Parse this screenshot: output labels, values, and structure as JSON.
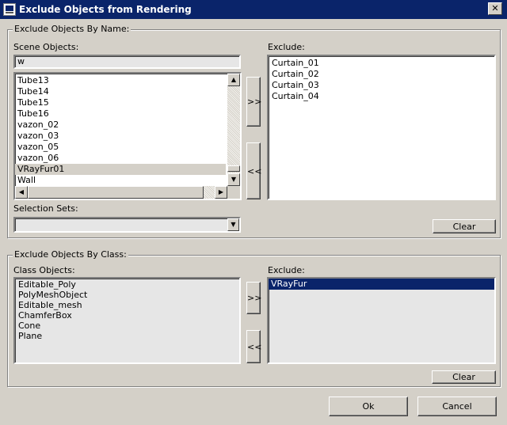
{
  "window": {
    "title": "Exclude Objects from Rendering",
    "close_glyph": "✕"
  },
  "by_name": {
    "group_title": "Exclude Objects By Name:",
    "scene_label": "Scene Objects:",
    "filter_value": "w",
    "scene_items": [
      "Tube13",
      "Tube14",
      "Tube15",
      "Tube16",
      "vazon_02",
      "vazon_03",
      "vazon_05",
      "vazon_06",
      "VRayFur01",
      "Wall"
    ],
    "focused_item": "VRayFur01",
    "add_label": ">>",
    "remove_label": "<<",
    "exclude_label": "Exclude:",
    "exclude_items": [
      "Curtain_01",
      "Curtain_02",
      "Curtain_03",
      "Curtain_04"
    ],
    "selection_sets_label": "Selection Sets:",
    "selection_sets_value": "",
    "clear_label": "Clear"
  },
  "by_class": {
    "group_title": "Exclude Objects By Class:",
    "class_label": "Class Objects:",
    "class_items": [
      "Editable_Poly",
      "PolyMeshObject",
      "Editable_mesh",
      "ChamferBox",
      "Cone",
      "Plane"
    ],
    "add_label": ">>",
    "remove_label": "<<",
    "exclude_label": "Exclude:",
    "exclude_items": [
      "VRayFur"
    ],
    "selected_item": "VRayFur",
    "clear_label": "Clear"
  },
  "footer": {
    "ok_label": "Ok",
    "cancel_label": "Cancel"
  }
}
